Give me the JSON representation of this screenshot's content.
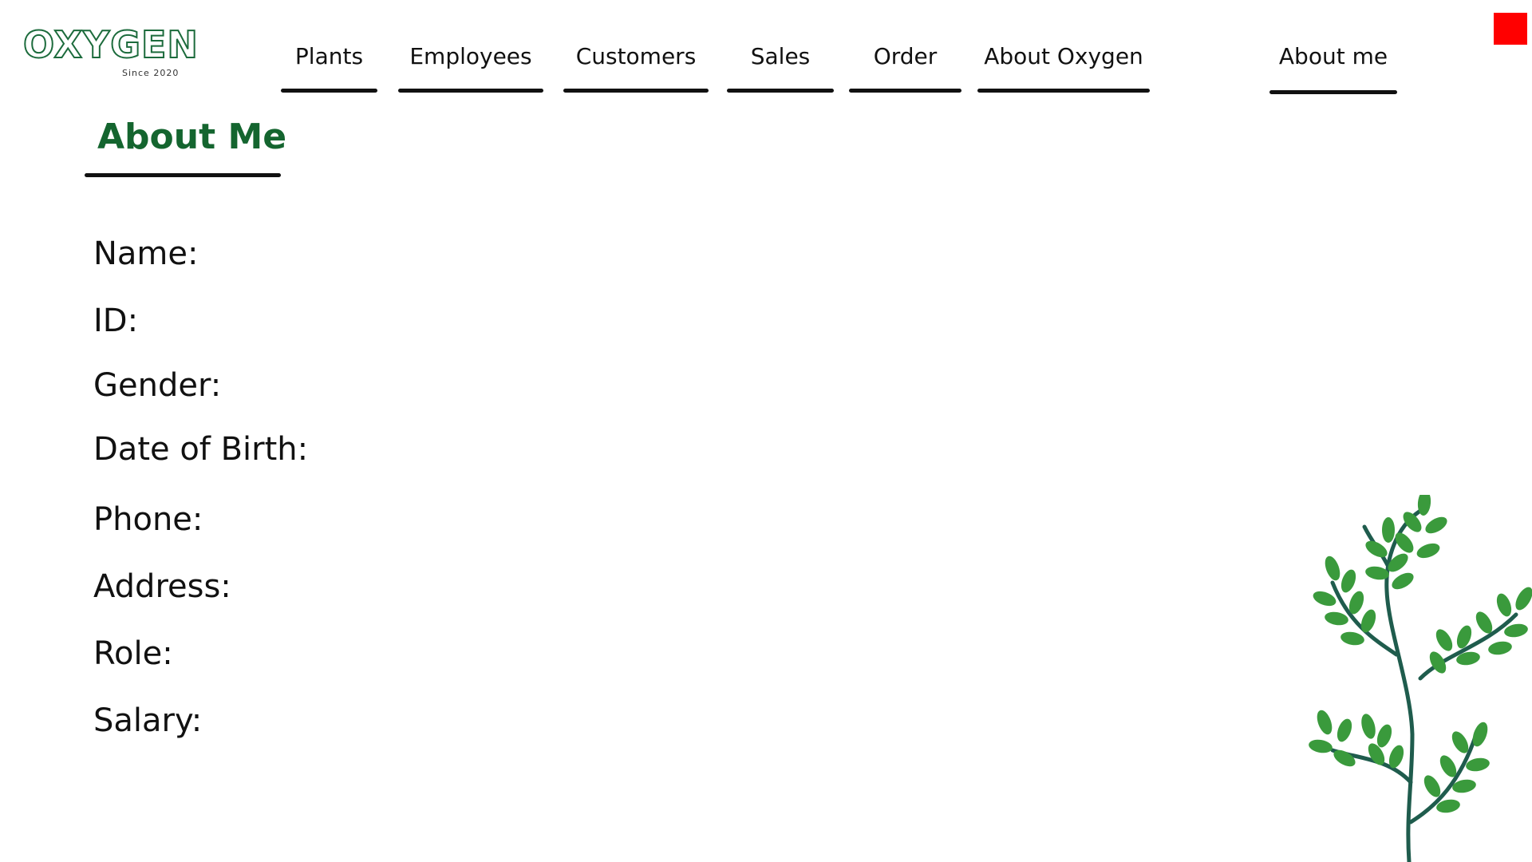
{
  "logo": {
    "wordmark": "OXYGEN",
    "tagline": "Since 2020"
  },
  "nav": {
    "items": [
      {
        "label": "Plants"
      },
      {
        "label": "Employees"
      },
      {
        "label": "Customers"
      },
      {
        "label": "Sales"
      },
      {
        "label": "Order"
      },
      {
        "label": "About Oxygen"
      },
      {
        "label": "About me"
      }
    ]
  },
  "page": {
    "title": "About Me"
  },
  "fields": [
    {
      "label": "Name:"
    },
    {
      "label": "ID:"
    },
    {
      "label": "Gender:"
    },
    {
      "label": "Date of Birth:"
    },
    {
      "label": "Phone:"
    },
    {
      "label": "Address:"
    },
    {
      "label": "Role:"
    },
    {
      "label": "Salary:"
    }
  ],
  "colors": {
    "brand_green": "#14652f",
    "leaf_green": "#3a9a3c",
    "stem": "#1f5c4d",
    "close_red": "#ff0000",
    "text": "#111111"
  },
  "icons": {
    "corner_square": "red-square-icon",
    "decoration": "plant-branch-illustration"
  }
}
